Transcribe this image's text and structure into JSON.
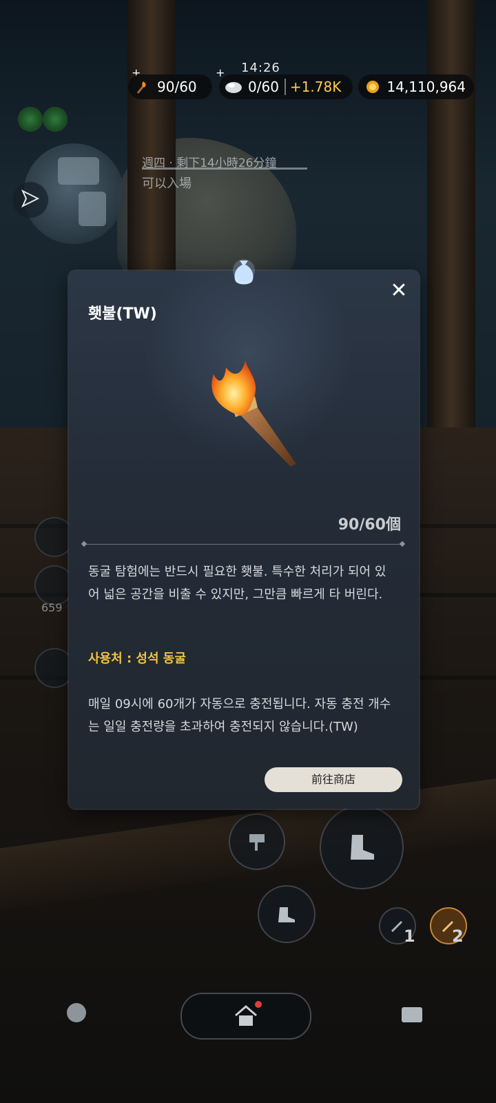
{
  "hud": {
    "time": "14:26",
    "plus_symbol": "+",
    "torch_count": "90/60",
    "silver_count": "0/60",
    "silver_bonus": "+1.78K",
    "gold_amount": "14,110,964"
  },
  "event": {
    "line1": "週四 · 剩下14小時26分鐘",
    "line2": "可以入場"
  },
  "side": {
    "stamina_value": "659"
  },
  "skills": {
    "skill1_level": "1",
    "skill2_level": "2"
  },
  "item_popup": {
    "title": "횃불(TW)",
    "close_label": "✕",
    "count_text": "90/60個",
    "description": "동굴 탐험에는 반드시 필요한 횃불. 특수한 처리가 되어 있어 넓은 공간을 비출 수 있지만, 그만큼 빠르게 타 버린다.",
    "usage": "사용처 : 성석 동굴",
    "charge_info": "매일 09시에 60개가 자동으로 충전됩니다. 자동 충전 개수는 일일 충전량을 초과하여 충전되지 않습니다.(TW)",
    "shop_button": "前往商店"
  },
  "colors": {
    "accent_gold": "#f5c542",
    "bonus_gold": "#ffcc4d",
    "modal_bg": "#242c38",
    "button_light": "#e5e0d7"
  },
  "icons": {
    "torch": "torch-icon",
    "silver": "silver-ore-icon",
    "gold": "gold-coin-icon",
    "close": "close-icon",
    "nav": "navigation-arrow-icon",
    "home": "home-icon"
  }
}
